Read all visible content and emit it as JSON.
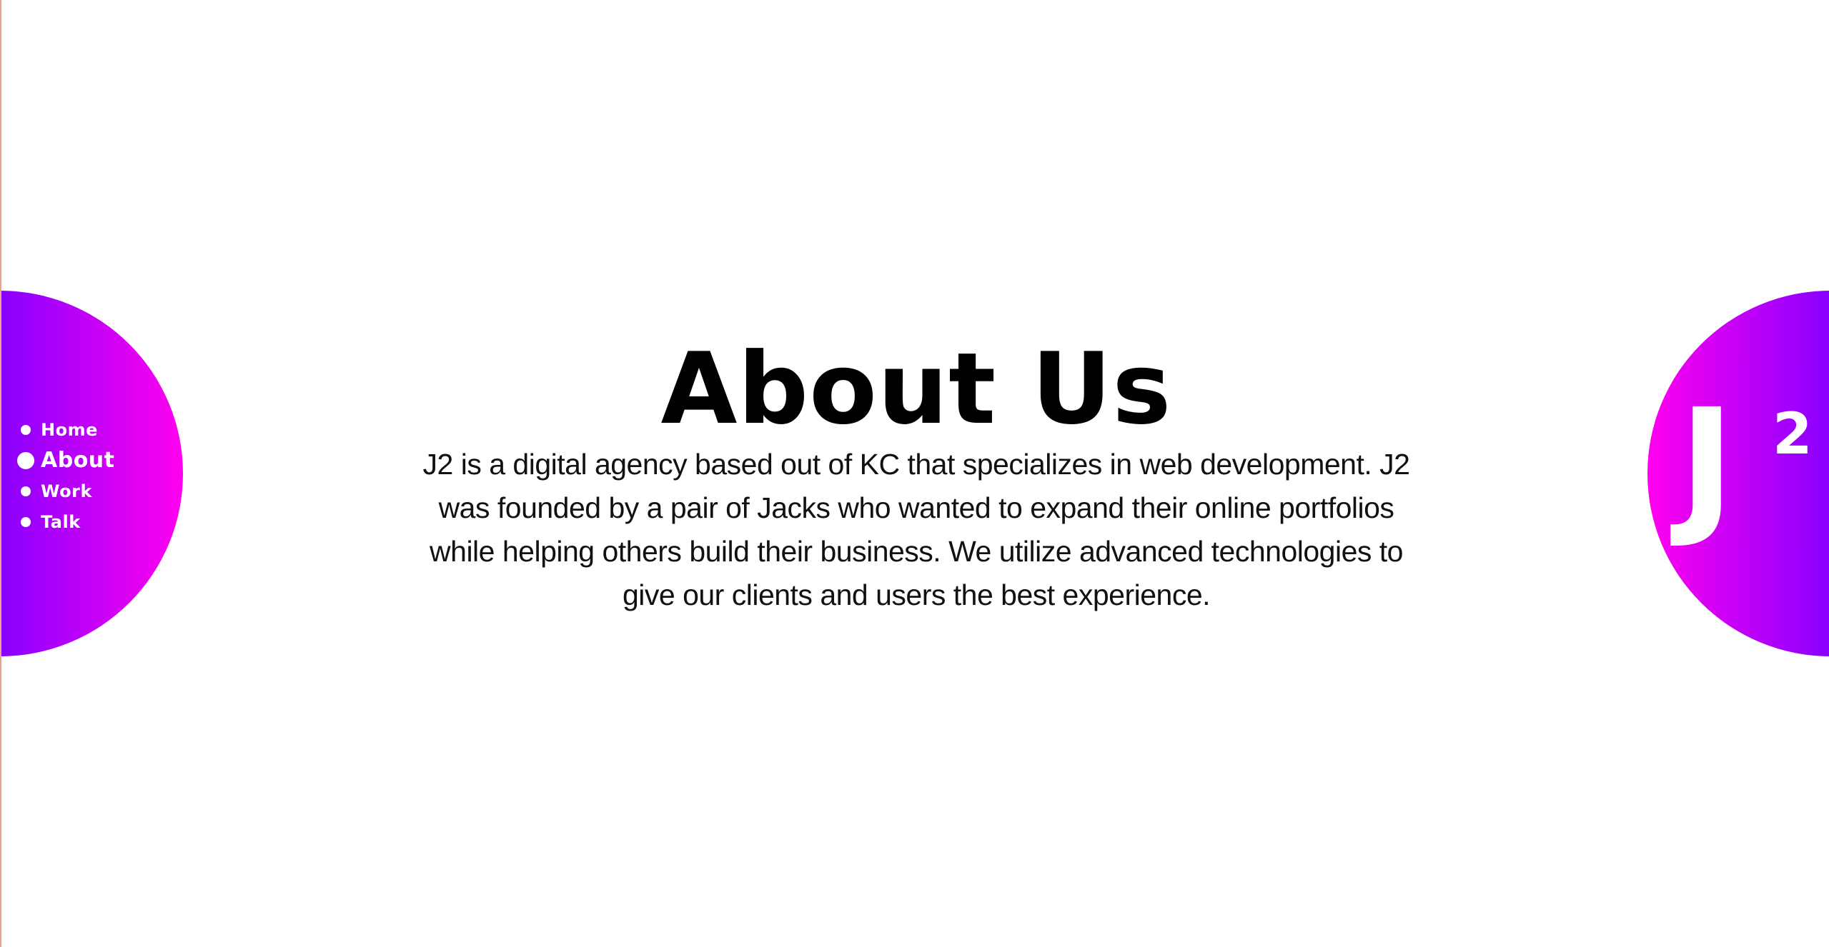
{
  "nav": {
    "items": [
      {
        "label": "Home",
        "active": false
      },
      {
        "label": "About",
        "active": true
      },
      {
        "label": "Work",
        "active": false
      },
      {
        "label": "Talk",
        "active": false
      }
    ]
  },
  "logo": {
    "letter": "J",
    "superscript": "2"
  },
  "main": {
    "title": "About Us",
    "description": "J2 is a digital agency based out of KC that specializes in web development. J2 was founded by a pair of Jacks who wanted to expand their online portfolios while helping others build their business. We utilize advanced technologies to give our clients and users the best experience."
  },
  "colors": {
    "gradient_purple": "#8800ff",
    "gradient_magenta": "#ff00ee",
    "text": "#000000",
    "background": "#ffffff"
  }
}
